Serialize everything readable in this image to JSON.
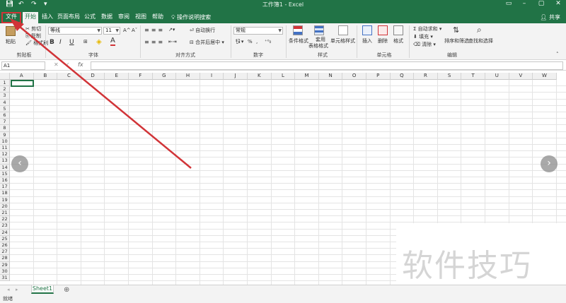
{
  "titlebar": {
    "title": "工作簿1  -  Excel",
    "save_icon": "save-icon",
    "undo_icon": "undo-icon",
    "redo_icon": "redo-icon"
  },
  "tabs": [
    {
      "label": "文件"
    },
    {
      "label": "开始"
    },
    {
      "label": "插入"
    },
    {
      "label": "页面布局"
    },
    {
      "label": "公式"
    },
    {
      "label": "数据"
    },
    {
      "label": "审阅"
    },
    {
      "label": "视图"
    },
    {
      "label": "帮助"
    }
  ],
  "tellme": "操作说明搜索",
  "share": "共享",
  "ribbon": {
    "clipboard": {
      "paste": "粘贴",
      "cut": "剪切",
      "copy": "复制",
      "format_painter": "格式刷",
      "label": "剪贴板"
    },
    "font": {
      "name": "等线",
      "size": "11",
      "bold": "B",
      "italic": "I",
      "underline": "U",
      "font_color_glyph": "A",
      "grow": "A^",
      "shrink": "Aˇ",
      "label": "字体"
    },
    "alignment": {
      "wrap": "自动换行",
      "merge": "合并后居中",
      "label": "对齐方式"
    },
    "number": {
      "format": "常规",
      "percent": "%",
      "comma": ",",
      "label": "数字"
    },
    "styles": {
      "conditional": "条件格式",
      "table_line1": "套用",
      "table_line2": "表格格式",
      "cell_styles": "单元格样式",
      "label": "样式"
    },
    "cells": {
      "insert": "插入",
      "delete": "删除",
      "format": "格式",
      "label": "单元格"
    },
    "editing": {
      "autosum": "自动求和",
      "fill": "填充",
      "clear": "清除",
      "sort": "排序和筛选",
      "find": "查找和选择",
      "label": "编辑"
    }
  },
  "formula": {
    "namebox": "A1",
    "fx": "fx"
  },
  "columns": [
    "A",
    "B",
    "C",
    "D",
    "E",
    "F",
    "G",
    "H",
    "I",
    "J",
    "K",
    "L",
    "M",
    "N",
    "O",
    "P",
    "Q",
    "R",
    "S",
    "T",
    "U",
    "V",
    "W"
  ],
  "rows": [
    "1",
    "2",
    "3",
    "4",
    "5",
    "6",
    "7",
    "8",
    "9",
    "10",
    "11",
    "12",
    "13",
    "14",
    "15",
    "16",
    "17",
    "18",
    "19",
    "20",
    "21",
    "22",
    "23",
    "24",
    "25",
    "26",
    "27",
    "28",
    "29",
    "30",
    "31"
  ],
  "sheet_tab": "Sheet1",
  "add_sheet": "⊕",
  "status": "就绪",
  "nav": {
    "left": "‹",
    "right": "›"
  },
  "watermark": "软件技巧",
  "colors": {
    "excel_green": "#217346",
    "annotation_red": "#d13438"
  }
}
